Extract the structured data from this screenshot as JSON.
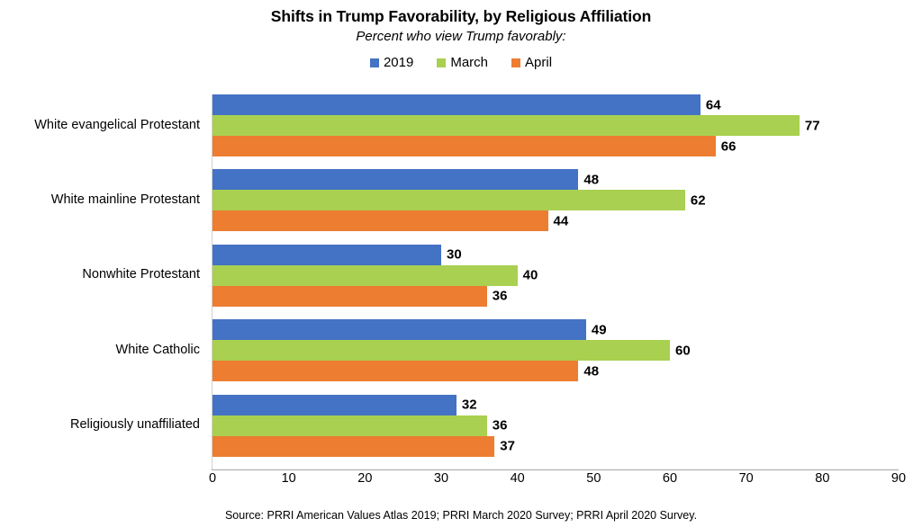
{
  "chart_data": {
    "type": "bar",
    "orientation": "horizontal",
    "title": "Shifts in Trump Favorability, by Religious Affiliation",
    "subtitle": "Percent who view Trump favorably:",
    "xlabel": "",
    "ylabel": "",
    "xlim": [
      0,
      90
    ],
    "xticks": [
      0,
      10,
      20,
      30,
      40,
      50,
      60,
      70,
      80,
      90
    ],
    "grid": false,
    "legend_position": "top-center",
    "categories": [
      "White evangelical Protestant",
      "White mainline Protestant",
      "Nonwhite Protestant",
      "White Catholic",
      "Religiously unaffiliated"
    ],
    "series": [
      {
        "name": "2019",
        "color": "#4472C4",
        "values": [
          64,
          48,
          30,
          49,
          32
        ]
      },
      {
        "name": "March",
        "color": "#A9D050",
        "values": [
          77,
          62,
          40,
          60,
          36
        ]
      },
      {
        "name": "April",
        "color": "#ED7D31",
        "values": [
          66,
          44,
          36,
          48,
          37
        ]
      }
    ],
    "source": "Source: PRRI American Values Atlas 2019; PRRI March 2020 Survey; PRRI April 2020 Survey."
  }
}
